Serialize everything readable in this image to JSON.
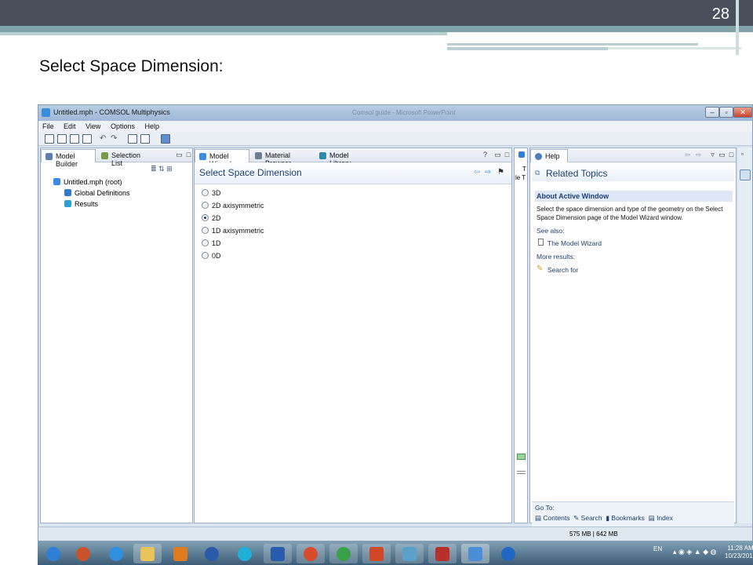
{
  "slide": {
    "page_number": "28",
    "heading": "Select Space Dimension:"
  },
  "window": {
    "title": "Untitled.mph - COMSOL Multiphysics",
    "ghost_title": "Comsol guide - Microsoft PowerPoint",
    "min_symbol": "–",
    "max_symbol": "▫",
    "close_symbol": "✕"
  },
  "menu": [
    "File",
    "Edit",
    "View",
    "Options",
    "Help"
  ],
  "model_builder": {
    "tabs": [
      "Model Builder",
      "Selection List"
    ],
    "tree": [
      {
        "label": "Untitled.mph (root)",
        "icon": "model-icon",
        "color": "#3a8dde"
      },
      {
        "label": "Global Definitions",
        "icon": "definitions-icon",
        "color": "#3579c9"
      },
      {
        "label": "Results",
        "icon": "results-icon",
        "color": "#2f9ed2"
      }
    ]
  },
  "wizard": {
    "tabs": [
      "Model Wizard",
      "Material Browser",
      "Model Library"
    ],
    "title": "Select Space Dimension",
    "options": [
      {
        "label": "3D",
        "selected": false
      },
      {
        "label": "2D axisymmetric",
        "selected": false
      },
      {
        "label": "2D",
        "selected": true
      },
      {
        "label": "1D axisymmetric",
        "selected": false
      },
      {
        "label": "1D",
        "selected": false
      },
      {
        "label": "0D",
        "selected": false
      }
    ],
    "nav_back": "⇦",
    "nav_fwd": "⇨"
  },
  "side_strip": {
    "line1": "T",
    "line2": "le T"
  },
  "help": {
    "tab": "Help",
    "title": "Related Topics",
    "section": "About Active Window",
    "text": "Select the space dimension and type of the geometry on the Select Space Dimension page of the Model Wizard window.",
    "see_also_label": "See also:",
    "see_also_link": "The Model Wizard",
    "more_label": "More results:",
    "more_link": "Search for",
    "goto_label": "Go To:",
    "goto_links": [
      "Contents",
      "Search",
      "Bookmarks",
      "Index"
    ]
  },
  "status": {
    "memory": "575 MB | 642 MB"
  },
  "taskbar": {
    "lang": "EN",
    "time": "11:28 AM",
    "date": "10/23/2012",
    "apps": [
      {
        "name": "start-orb",
        "color": "#2f7fd6"
      },
      {
        "name": "app-icon",
        "color": "#c9542b"
      },
      {
        "name": "ie-icon",
        "color": "#2f8fe0"
      },
      {
        "name": "folder-icon",
        "color": "#e8c45a"
      },
      {
        "name": "media-icon",
        "color": "#e07a1f"
      },
      {
        "name": "hp-icon",
        "color": "#2a5aa8"
      },
      {
        "name": "globe-icon",
        "color": "#1fb0d8"
      },
      {
        "name": "word-icon",
        "color": "#2a5cad"
      },
      {
        "name": "chrome-icon",
        "color": "#d84c2e"
      },
      {
        "name": "chrome-icon-2",
        "color": "#3aa14b"
      },
      {
        "name": "powerpoint-icon",
        "color": "#d24826"
      },
      {
        "name": "paint-icon",
        "color": "#5aa0c8"
      },
      {
        "name": "pdf-icon",
        "color": "#b8302a"
      },
      {
        "name": "comsol-icon",
        "color": "#4a8fd6"
      },
      {
        "name": "blue-b-icon",
        "color": "#1f67c2"
      }
    ]
  }
}
